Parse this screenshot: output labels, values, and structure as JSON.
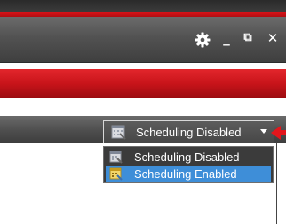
{
  "window": {
    "controls": [
      "_",
      "⧉",
      "✕"
    ]
  },
  "icons": {
    "settings": "gear-icon",
    "schedule": "calendar-icon",
    "schedule_enabled": "calendar-enabled-icon"
  },
  "scheduling": {
    "selected": "Scheduling Disabled",
    "options": [
      "Scheduling Disabled",
      "Scheduling Enabled"
    ],
    "highlighted_index": 1
  },
  "colors": {
    "accent_red": "#d01a20",
    "highlight_blue": "#3e8ed8"
  }
}
